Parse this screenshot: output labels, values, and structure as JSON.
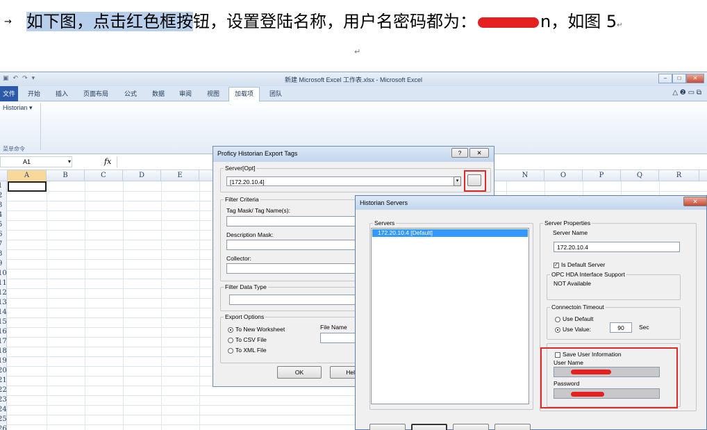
{
  "instruction": {
    "arrow": "→",
    "highlighted": "如下图，点击红色框按",
    "rest": "钮，设置登陆名称，用户名密码都为：",
    "tail_visible": "n，",
    "after": "如图 5",
    "para_mark": "↵",
    "return_mark": "↵"
  },
  "excel": {
    "window_title": "新建 Microsoft Excel 工作表.xlsx - Microsoft Excel",
    "qat": [
      "▣",
      "↶",
      "↷",
      "▾"
    ],
    "window_buttons": [
      "–",
      "□",
      "✕"
    ],
    "tabs": [
      "文件",
      "开始",
      "插入",
      "页面布局",
      "公式",
      "数据",
      "审阅",
      "视图",
      "加载项",
      "团队"
    ],
    "ribbon_right": "△ ❷ ▭ ⧉",
    "historian_button": "Historian ▾",
    "group_label": "菜单命令",
    "name_box": "A1",
    "fx": "fx",
    "columns": [
      "A",
      "B",
      "C",
      "D",
      "E",
      "N",
      "O",
      "P",
      "Q",
      "R"
    ],
    "rows": [
      "1",
      "2",
      "3",
      "4",
      "5",
      "6",
      "7",
      "8",
      "9",
      "10",
      "11",
      "12",
      "13",
      "14",
      "15",
      "16",
      "17",
      "18",
      "19",
      "20",
      "21",
      "22",
      "23",
      "24",
      "25",
      "26"
    ]
  },
  "export_dialog": {
    "title": "Proficy Historian Export Tags",
    "title_buttons": [
      "?",
      "✕"
    ],
    "server_group": "Server[Opt]",
    "server_value": "[172.20.10.4]",
    "filter_group": "Filter Criteria",
    "tag_mask_label": "Tag Mask/ Tag Name(s):",
    "description_label": "Description Mask:",
    "collector_label": "Collector:",
    "datatype_group": "Filter Data Type",
    "export_group": "Export Options",
    "opt_worksheet": "To New Worksheet",
    "opt_csv": "To CSV File",
    "opt_xml": "To XML File",
    "file_name_label": "File Name",
    "ok_label": "OK",
    "help_label": "Help"
  },
  "servers_dialog": {
    "title": "Historian Servers",
    "close": "✕",
    "servers_group": "Servers",
    "server_item": "172.20.10.4 [Default]",
    "props_group": "Server Properties",
    "server_name_label": "Server Name",
    "server_name_value": "172.20.10.4",
    "default_check": "Is Default Server",
    "opc_group": "OPC HDA Interface Support",
    "opc_value": "NOT Available",
    "timeout_group": "Connectoin Timeout",
    "use_default": "Use Default",
    "use_value": "Use Value:",
    "timeout_value": "90",
    "sec_label": "Sec",
    "save_user": "Save User Information",
    "user_label": "User Name",
    "password_label": "Password"
  },
  "colors": {
    "highlight": "#b7cfea",
    "annotation_red": "#e02a2a",
    "file_tab": "#2a5aa8",
    "selection": "#3399ff"
  }
}
